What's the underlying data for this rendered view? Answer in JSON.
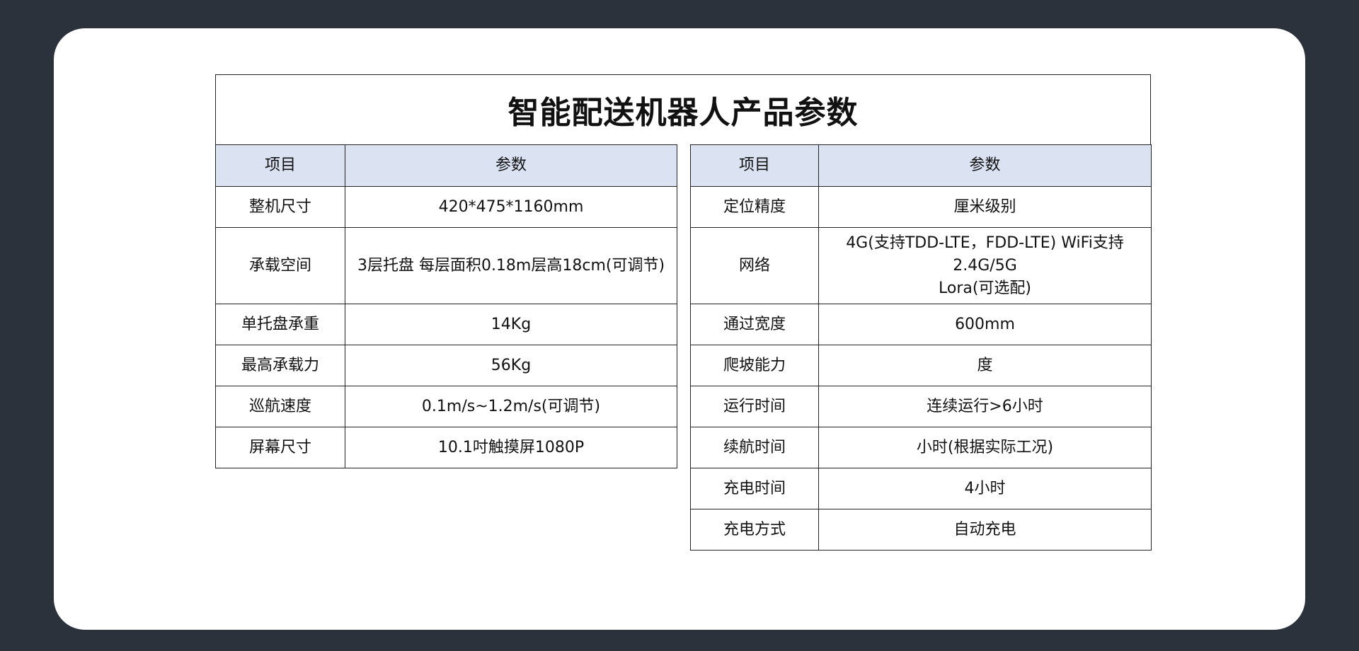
{
  "title": "智能配送机器人产品参数",
  "left_table": {
    "headers": [
      "项目",
      "参数"
    ],
    "rows": [
      {
        "item": "整机尺寸",
        "value": "420*475*1160mm"
      },
      {
        "item": "承载空间",
        "value": "3层托盘 每层面积0.18m层高18cm(可调节)"
      },
      {
        "item": "单托盘承重",
        "value": "14Kg"
      },
      {
        "item": "最高承载力",
        "value": "56Kg"
      },
      {
        "item": "巡航速度",
        "value": "0.1m/s~1.2m/s(可调节)"
      },
      {
        "item": "屏幕尺寸",
        "value": "10.1吋触摸屏1080P"
      }
    ]
  },
  "right_table": {
    "headers": [
      "项目",
      "参数"
    ],
    "rows": [
      {
        "item": "定位精度",
        "value": "厘米级别"
      },
      {
        "item": "网络",
        "value": "4G(支持TDD-LTE，FDD-LTE) WiFi支持\n2.4G/5G\nLora(可选配)"
      },
      {
        "item": "通过宽度",
        "value": "600mm"
      },
      {
        "item": "爬坡能力",
        "value": "度"
      },
      {
        "item": "运行时间",
        "value": "连续运行>6小时"
      },
      {
        "item": "续航时间",
        "value": "小时(根据实际工况)"
      },
      {
        "item": "充电时间",
        "value": "4小时"
      },
      {
        "item": "充电方式",
        "value": "自动充电"
      }
    ]
  },
  "colors": {
    "background": "#2b323c",
    "card": "#ffffff",
    "header_fill": "#dbe3f3",
    "border": "#222222"
  }
}
